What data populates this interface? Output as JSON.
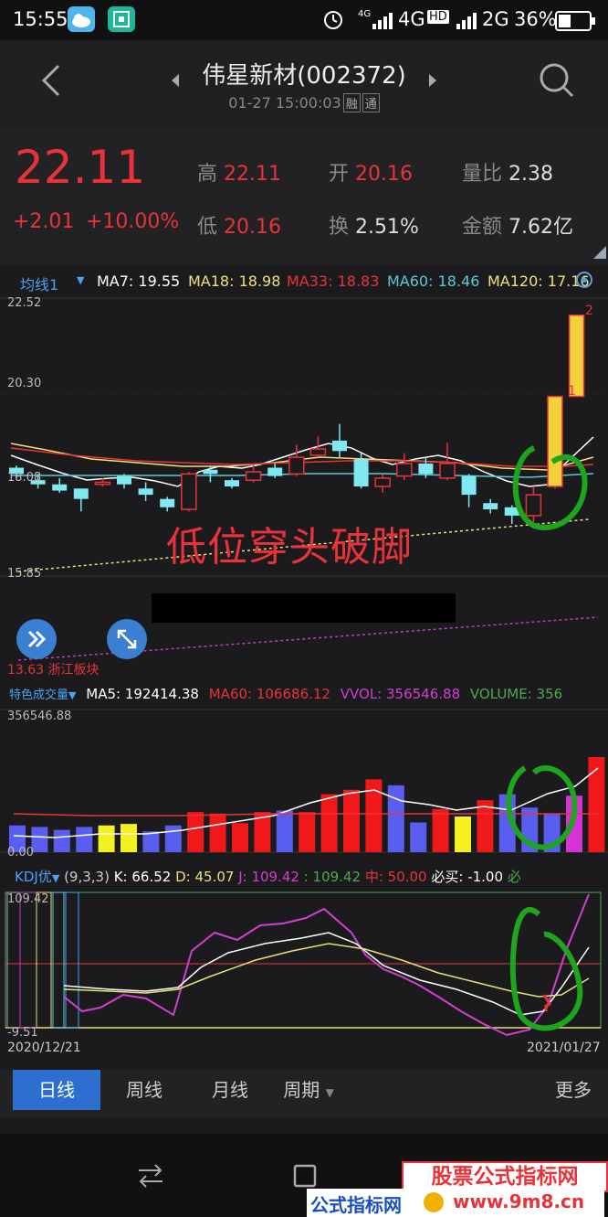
{
  "status": {
    "time": "15:55",
    "net1": "4G",
    "net2": "2G",
    "battery": "36%",
    "hd": "HD"
  },
  "header": {
    "title": "伟星新材(002372)",
    "datetime": "01-27 15:00:03",
    "tag1": "融",
    "tag2": "通"
  },
  "quote": {
    "price": "22.11",
    "change": "+2.01",
    "change_pct": "+10.00%",
    "high_label": "高",
    "high": "22.11",
    "open_label": "开",
    "open": "20.16",
    "vol_ratio_label": "量比",
    "vol_ratio": "2.38",
    "low_label": "低",
    "low": "20.16",
    "turnover_label": "换",
    "turnover": "2.51%",
    "amount_label": "金额",
    "amount": "7.62亿"
  },
  "ma_legend": {
    "name": "均线1",
    "ma7": "MA7: 19.55",
    "ma18": "MA18: 18.98",
    "ma33": "MA33: 18.83",
    "ma60": "MA60: 18.46",
    "ma120": "MA120: 17.16"
  },
  "price_chart": {
    "y_top": "22.52",
    "y_mid": "20.30",
    "y_low": "18.08",
    "y_bottom": "15.85",
    "below_label": "13.63",
    "sector_label": "浙江板块",
    "annotation": "低位穿头破脚",
    "marker1": "1",
    "marker2": "2"
  },
  "volume_legend": {
    "name": "特色成交量",
    "ma5": "MA5: 192414.38",
    "ma60": "MA60: 106686.12",
    "vvol": "VVOL: 356546.88",
    "volume": "VOLUME: 356",
    "y_top": "356546.88",
    "y_bottom": "0.00"
  },
  "kdj_legend": {
    "name": "KDJ优",
    "params": "(9,3,3)",
    "k": "K: 66.52",
    "d": "D: 45.07",
    "j": "J: 109.42",
    "extra": ": 109.42",
    "mid": "中: 50.00",
    "buy": "必买: -1.00",
    "must": "必",
    "y_top": "109.42",
    "y_bottom": "-9.51",
    "date_start": "2020/12/21",
    "date_end": "2021/01/27"
  },
  "tabs": {
    "day": "日线",
    "week": "周线",
    "month": "月线",
    "period": "周期",
    "more": "更多"
  },
  "watermark": {
    "top": "股票公式指标网",
    "bottom": "公式指标网",
    "url": "www.9m8.cn"
  },
  "chart_data": {
    "type": "candlestick",
    "candles": [
      {
        "o": 18.45,
        "c": 18.3,
        "h": 18.5,
        "l": 18.2,
        "color": "cyan"
      },
      {
        "o": 18.15,
        "c": 18.05,
        "h": 18.3,
        "l": 17.95,
        "color": "cyan"
      },
      {
        "o": 18.05,
        "c": 17.9,
        "h": 18.2,
        "l": 17.85,
        "color": "cyan"
      },
      {
        "o": 17.95,
        "c": 17.7,
        "h": 17.95,
        "l": 17.4,
        "color": "cyan"
      },
      {
        "o": 18.05,
        "c": 18.1,
        "h": 18.2,
        "l": 18.0,
        "color": "red"
      },
      {
        "o": 18.05,
        "c": 18.25,
        "h": 18.3,
        "l": 17.95,
        "color": "cyan"
      },
      {
        "o": 17.8,
        "c": 17.95,
        "h": 18.1,
        "l": 17.65,
        "color": "cyan"
      },
      {
        "o": 17.7,
        "c": 17.5,
        "h": 17.75,
        "l": 17.4,
        "color": "cyan"
      },
      {
        "o": 17.45,
        "c": 18.3,
        "h": 18.35,
        "l": 17.4,
        "color": "red"
      },
      {
        "o": 18.3,
        "c": 18.4,
        "h": 18.5,
        "l": 18.1,
        "color": "cyan"
      },
      {
        "o": 18.15,
        "c": 18.0,
        "h": 18.2,
        "l": 17.95,
        "color": "cyan"
      },
      {
        "o": 18.15,
        "c": 18.35,
        "h": 18.55,
        "l": 18.1,
        "color": "red"
      },
      {
        "o": 18.25,
        "c": 18.45,
        "h": 18.55,
        "l": 18.2,
        "color": "cyan"
      },
      {
        "o": 18.3,
        "c": 18.7,
        "h": 19.0,
        "l": 18.25,
        "color": "red"
      },
      {
        "o": 18.75,
        "c": 18.9,
        "h": 19.2,
        "l": 18.7,
        "color": "red"
      },
      {
        "o": 19.1,
        "c": 18.85,
        "h": 19.5,
        "l": 18.7,
        "color": "cyan"
      },
      {
        "o": 18.65,
        "c": 18.0,
        "h": 18.8,
        "l": 17.95,
        "color": "cyan"
      },
      {
        "o": 18.0,
        "c": 18.2,
        "h": 18.3,
        "l": 17.85,
        "color": "red"
      },
      {
        "o": 18.25,
        "c": 18.55,
        "h": 18.8,
        "l": 18.15,
        "color": "red"
      },
      {
        "o": 18.55,
        "c": 18.3,
        "h": 18.7,
        "l": 18.2,
        "color": "cyan"
      },
      {
        "o": 18.2,
        "c": 18.55,
        "h": 19.05,
        "l": 18.15,
        "color": "red"
      },
      {
        "o": 18.25,
        "c": 17.8,
        "h": 18.3,
        "l": 17.5,
        "color": "cyan"
      },
      {
        "o": 17.6,
        "c": 17.45,
        "h": 17.7,
        "l": 17.35,
        "color": "cyan"
      },
      {
        "o": 17.5,
        "c": 17.3,
        "h": 17.55,
        "l": 17.1,
        "color": "cyan"
      },
      {
        "o": 17.3,
        "c": 17.8,
        "h": 18.0,
        "l": 17.0,
        "color": "red"
      },
      {
        "o": 18.0,
        "c": 20.16,
        "h": 20.16,
        "l": 17.95,
        "color": "yellow"
      },
      {
        "o": 20.16,
        "c": 22.11,
        "h": 22.11,
        "l": 20.16,
        "color": "yellow"
      }
    ],
    "volumes": [
      {
        "v": 0.09,
        "color": "blue"
      },
      {
        "v": 0.085,
        "color": "blue"
      },
      {
        "v": 0.075,
        "color": "blue"
      },
      {
        "v": 0.085,
        "color": "blue"
      },
      {
        "v": 0.09,
        "color": "yellow"
      },
      {
        "v": 0.095,
        "color": "yellow"
      },
      {
        "v": 0.07,
        "color": "blue"
      },
      {
        "v": 0.09,
        "color": "blue"
      },
      {
        "v": 0.135,
        "color": "red"
      },
      {
        "v": 0.13,
        "color": "red"
      },
      {
        "v": 0.098,
        "color": "red"
      },
      {
        "v": 0.135,
        "color": "red"
      },
      {
        "v": 0.14,
        "color": "blue"
      },
      {
        "v": 0.135,
        "color": "red"
      },
      {
        "v": 0.195,
        "color": "red"
      },
      {
        "v": 0.21,
        "color": "red"
      },
      {
        "v": 0.245,
        "color": "red"
      },
      {
        "v": 0.225,
        "color": "blue"
      },
      {
        "v": 0.1,
        "color": "blue"
      },
      {
        "v": 0.145,
        "color": "red"
      },
      {
        "v": 0.12,
        "color": "yellow"
      },
      {
        "v": 0.175,
        "color": "red"
      },
      {
        "v": 0.195,
        "color": "blue"
      },
      {
        "v": 0.15,
        "color": "blue"
      },
      {
        "v": 0.13,
        "color": "blue"
      },
      {
        "v": 0.19,
        "color": "magenta"
      },
      {
        "v": 0.32,
        "color": "red"
      },
      {
        "v": 0.45,
        "color": "red"
      }
    ]
  }
}
